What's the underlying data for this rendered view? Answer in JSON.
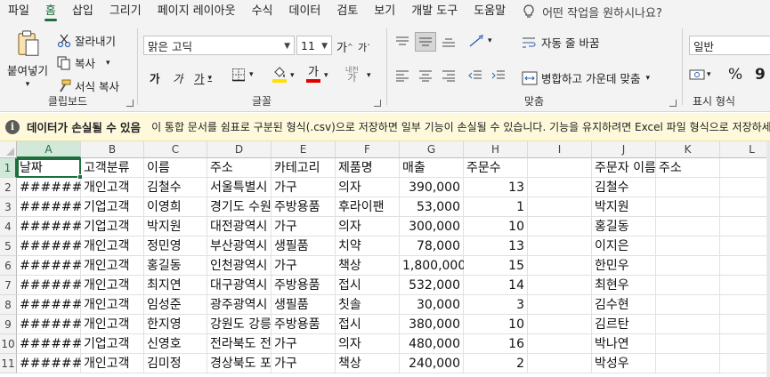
{
  "menu": {
    "tabs": [
      "파일",
      "홈",
      "삽입",
      "그리기",
      "페이지 레이아웃",
      "수식",
      "데이터",
      "검토",
      "보기",
      "개발 도구",
      "도움말"
    ],
    "active_index": 1,
    "tell_me": "어떤 작업을 원하시나요?"
  },
  "ribbon": {
    "clipboard": {
      "paste": "붙여넣기",
      "cut": "잘라내기",
      "copy": "복사",
      "format_painter": "서식 복사",
      "label": "클립보드"
    },
    "font": {
      "name": "맑은 고딕",
      "size": "11",
      "grow": "가",
      "shrink": "가",
      "bold": "가",
      "italic": "가",
      "underline": "가",
      "font_color": "가",
      "phonetic": "내천",
      "label": "글꼴",
      "fill_color": "#ffe000",
      "text_color": "#e00000"
    },
    "alignment": {
      "wrap_text": "자동 줄 바꿈",
      "merge_center": "병합하고 가운데 맞춤",
      "label": "맞춤"
    },
    "number": {
      "format": "일반",
      "percent": "%",
      "comma": "9",
      "label": "표시 형식"
    }
  },
  "infobar": {
    "title": "데이터가 손실될 수 있음",
    "message": "이 통합 문서를 쉼표로 구분된 형식(.csv)으로 저장하면 일부 기능이 손실될 수 있습니다. 기능을 유지하려면 Excel 파일 형식으로 저장하세요."
  },
  "grid": {
    "columns": [
      "A",
      "B",
      "C",
      "D",
      "E",
      "F",
      "G",
      "H",
      "I",
      "J",
      "K",
      "L"
    ],
    "selected_column": "A",
    "row_numbers": [
      "1",
      "2",
      "3",
      "4",
      "5",
      "6",
      "7",
      "8",
      "9",
      "10",
      "11"
    ],
    "selected_row": "1",
    "header_row": [
      "날짜",
      "고객분류",
      "이름",
      "주소",
      "카테고리",
      "제품명",
      "매출",
      "주문수",
      "",
      "주문자 이름",
      "주소",
      ""
    ],
    "rows": [
      [
        "#######",
        "개인고객",
        "김철수",
        "서울특별시",
        "가구",
        "의자",
        "390,000",
        "13",
        "",
        "김철수",
        "",
        ""
      ],
      [
        "#######",
        "기업고객",
        "이영희",
        "경기도 수원",
        "주방용품",
        "후라이팬",
        "53,000",
        "1",
        "",
        "박지원",
        "",
        ""
      ],
      [
        "#######",
        "기업고객",
        "박지원",
        "대전광역시",
        "가구",
        "의자",
        "300,000",
        "10",
        "",
        "홍길동",
        "",
        ""
      ],
      [
        "#######",
        "개인고객",
        "정민영",
        "부산광역시",
        "생필품",
        "치약",
        "78,000",
        "13",
        "",
        "이지은",
        "",
        ""
      ],
      [
        "#######",
        "개인고객",
        "홍길동",
        "인천광역시",
        "가구",
        "책상",
        "1,800,000",
        "15",
        "",
        "한민우",
        "",
        ""
      ],
      [
        "#######",
        "개인고객",
        "최지연",
        "대구광역시",
        "주방용품",
        "접시",
        "532,000",
        "14",
        "",
        "최현우",
        "",
        ""
      ],
      [
        "#######",
        "개인고객",
        "임성준",
        "광주광역시",
        "생필품",
        "칫솔",
        "30,000",
        "3",
        "",
        "김수현",
        "",
        ""
      ],
      [
        "#######",
        "개인고객",
        "한지영",
        "강원도 강릉",
        "주방용품",
        "접시",
        "380,000",
        "10",
        "",
        "김르탄",
        "",
        ""
      ],
      [
        "#######",
        "기업고객",
        "신영호",
        "전라북도 전",
        "가구",
        "의자",
        "480,000",
        "16",
        "",
        "박나연",
        "",
        ""
      ],
      [
        "#######",
        "개인고객",
        "김미정",
        "경상북도 포",
        "가구",
        "책상",
        "240,000",
        "2",
        "",
        "박성우",
        "",
        ""
      ]
    ]
  }
}
